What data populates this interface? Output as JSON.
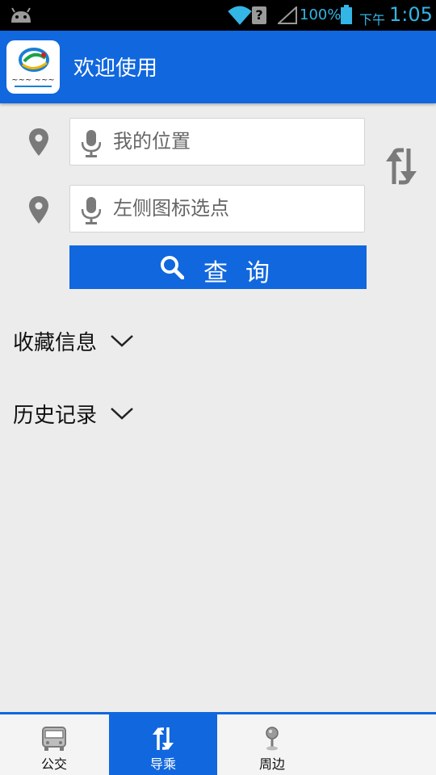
{
  "status_bar": {
    "battery": "100%",
    "ampm": "下午",
    "time": "1:05",
    "unknown_badge": "?",
    "color": "#33b5e5"
  },
  "action_bar": {
    "title": "欢迎使用",
    "logo_icon": "xining-bus-logo",
    "color": "#1167de"
  },
  "route_search": {
    "start": {
      "placeholder": "我的位置",
      "icon": "location-pin-icon",
      "mic_icon": "microphone-icon"
    },
    "end": {
      "placeholder": "左侧图标选点",
      "icon": "location-pin-icon",
      "mic_icon": "microphone-icon"
    },
    "swap_icon": "swap-arrows-icon",
    "query_button": {
      "label": "查询",
      "icon": "search-icon"
    }
  },
  "sections": {
    "favorites": {
      "label": "收藏信息",
      "icon": "chevron-down-icon"
    },
    "history": {
      "label": "历史记录",
      "icon": "chevron-down-icon"
    }
  },
  "tabs": [
    {
      "label": "公交",
      "icon": "bus-icon",
      "active": false
    },
    {
      "label": "导乘",
      "icon": "transfer-arrows-icon",
      "active": true
    },
    {
      "label": "周边",
      "icon": "map-pin-icon",
      "active": false
    }
  ]
}
